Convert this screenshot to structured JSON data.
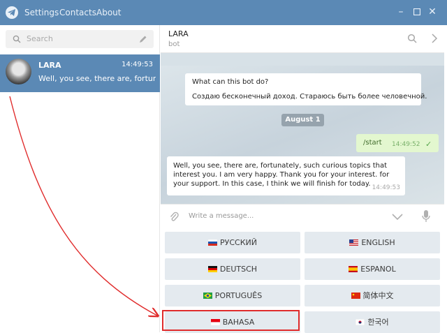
{
  "titlebar": {
    "menu": [
      "Settings",
      "Contacts",
      "About"
    ],
    "window_controls": [
      "minimize-icon",
      "maximize-icon",
      "close-icon"
    ]
  },
  "sidebar": {
    "search_placeholder": "Search",
    "chat": {
      "name": "LARA",
      "time": "14:49:53",
      "preview": "Well, you see, there are, fortunat..."
    }
  },
  "chat": {
    "header": {
      "title": "LARA",
      "subtitle": "bot"
    },
    "info": {
      "title": "What can this bot do?",
      "text": "Создаю бесконечный доход. Стараюсь быть более человечной."
    },
    "date_label": "August 1",
    "outgoing": {
      "text": "/start",
      "time": "14:49:52"
    },
    "incoming": {
      "text": "Well, you see, there are, fortunately, such curious topics that interest you. I am very happy. Thank you for your interest. for your support. In this case, I think we will finish for today.",
      "time": "14:49:53"
    },
    "composer_placeholder": "Write a message..."
  },
  "keyboard": [
    {
      "label": "РУССКИЙ",
      "flag": "ru"
    },
    {
      "label": "ENGLISH",
      "flag": "us"
    },
    {
      "label": "DEUTSCH",
      "flag": "de"
    },
    {
      "label": "ESPANOL",
      "flag": "es"
    },
    {
      "label": "PORTUGUÊS",
      "flag": "br"
    },
    {
      "label": "简体中文",
      "flag": "cn"
    },
    {
      "label": "BAHASA",
      "flag": "id"
    },
    {
      "label": "한국어",
      "flag": "kr"
    }
  ],
  "colors": {
    "titlebar": "#5b89b5",
    "selected_chat": "#5b89b5",
    "outgoing_bubble": "#e3f7cf",
    "highlight": "#e02c2c",
    "arrow": "#e02c2c"
  }
}
